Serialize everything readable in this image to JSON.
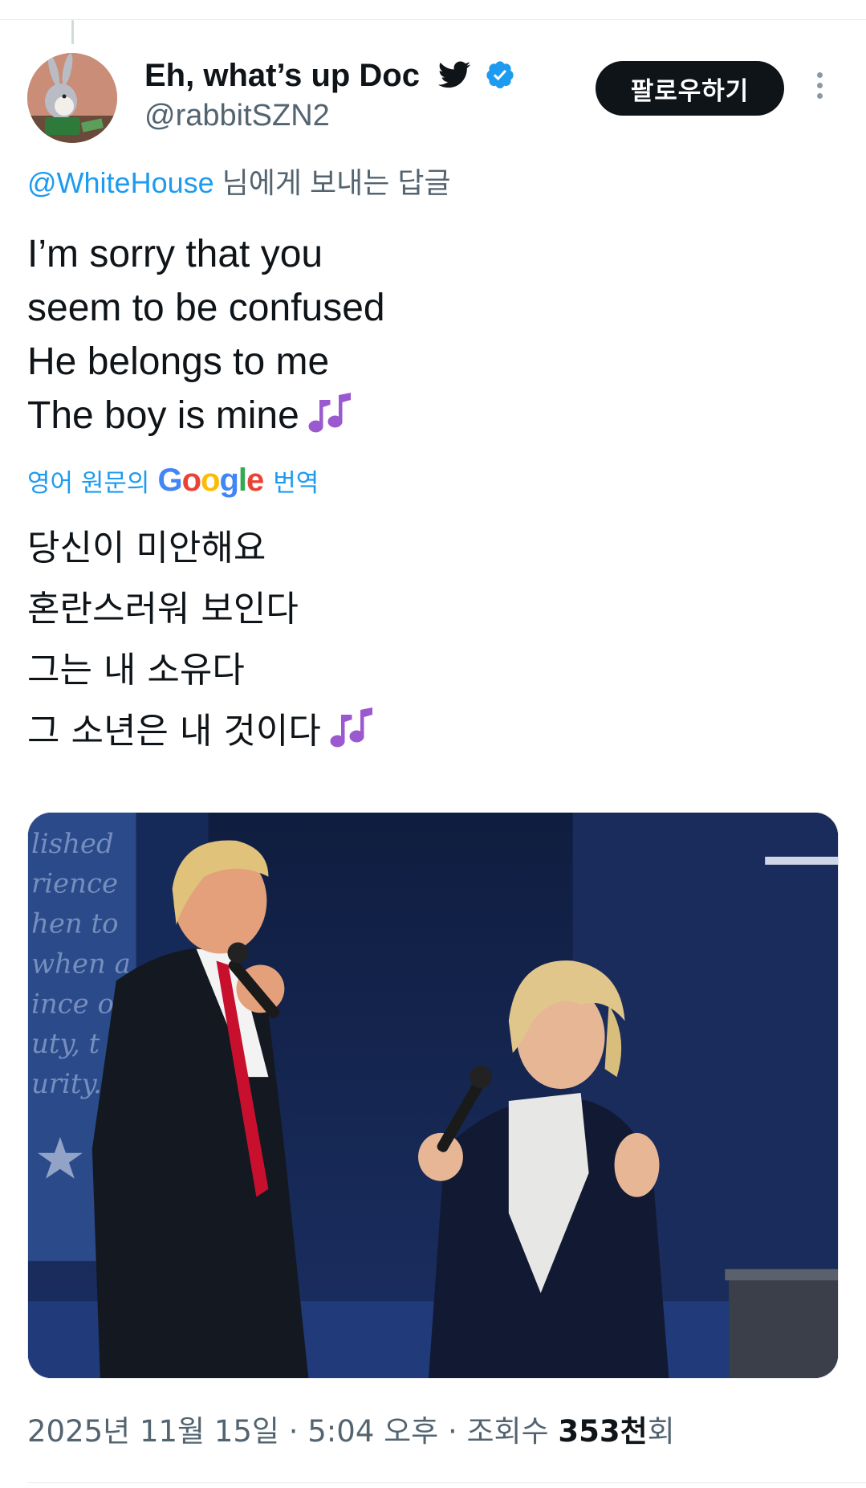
{
  "author": {
    "display_name": "Eh, what’s up Doc",
    "handle": "@rabbitSZN2",
    "avatar_icon": "bugs-bunny-avatar",
    "badges": [
      "twitter-bird-icon",
      "verified-badge-icon"
    ]
  },
  "follow_button": {
    "label": "팔로우하기"
  },
  "more_icon": "more-vertical-icon",
  "reply_context": {
    "mention": "@WhiteHouse",
    "suffix": " 님에게 보내는 답글"
  },
  "tweet": {
    "lines": [
      "I’m sorry that you",
      "seem to be confused",
      "He belongs to me",
      "The boy is mine"
    ],
    "emoji": "musical-notes-icon"
  },
  "translation": {
    "prefix": "영어 원문의",
    "provider": "Google",
    "suffix": "번역",
    "lines": [
      "당신이 미안해요",
      "혼란스러워 보인다",
      "그는 내 소유다",
      "그 소년은 내 것이다"
    ]
  },
  "media": {
    "photo": "debate-stage-photo",
    "backdrop_text": [
      "lished",
      "rience",
      "hen to",
      "when a",
      "ince o",
      "uty, t",
      "urity."
    ]
  },
  "meta": {
    "date": "2025년 11월 15일",
    "separator": " · ",
    "time": "5:04 오후",
    "views_label": "조회수 ",
    "views_value": "353천",
    "views_suffix": "회"
  },
  "colors": {
    "accent": "#1d9bf0",
    "text": "#0f1419",
    "secondary": "#536471",
    "follow_bg": "#0f1419"
  }
}
